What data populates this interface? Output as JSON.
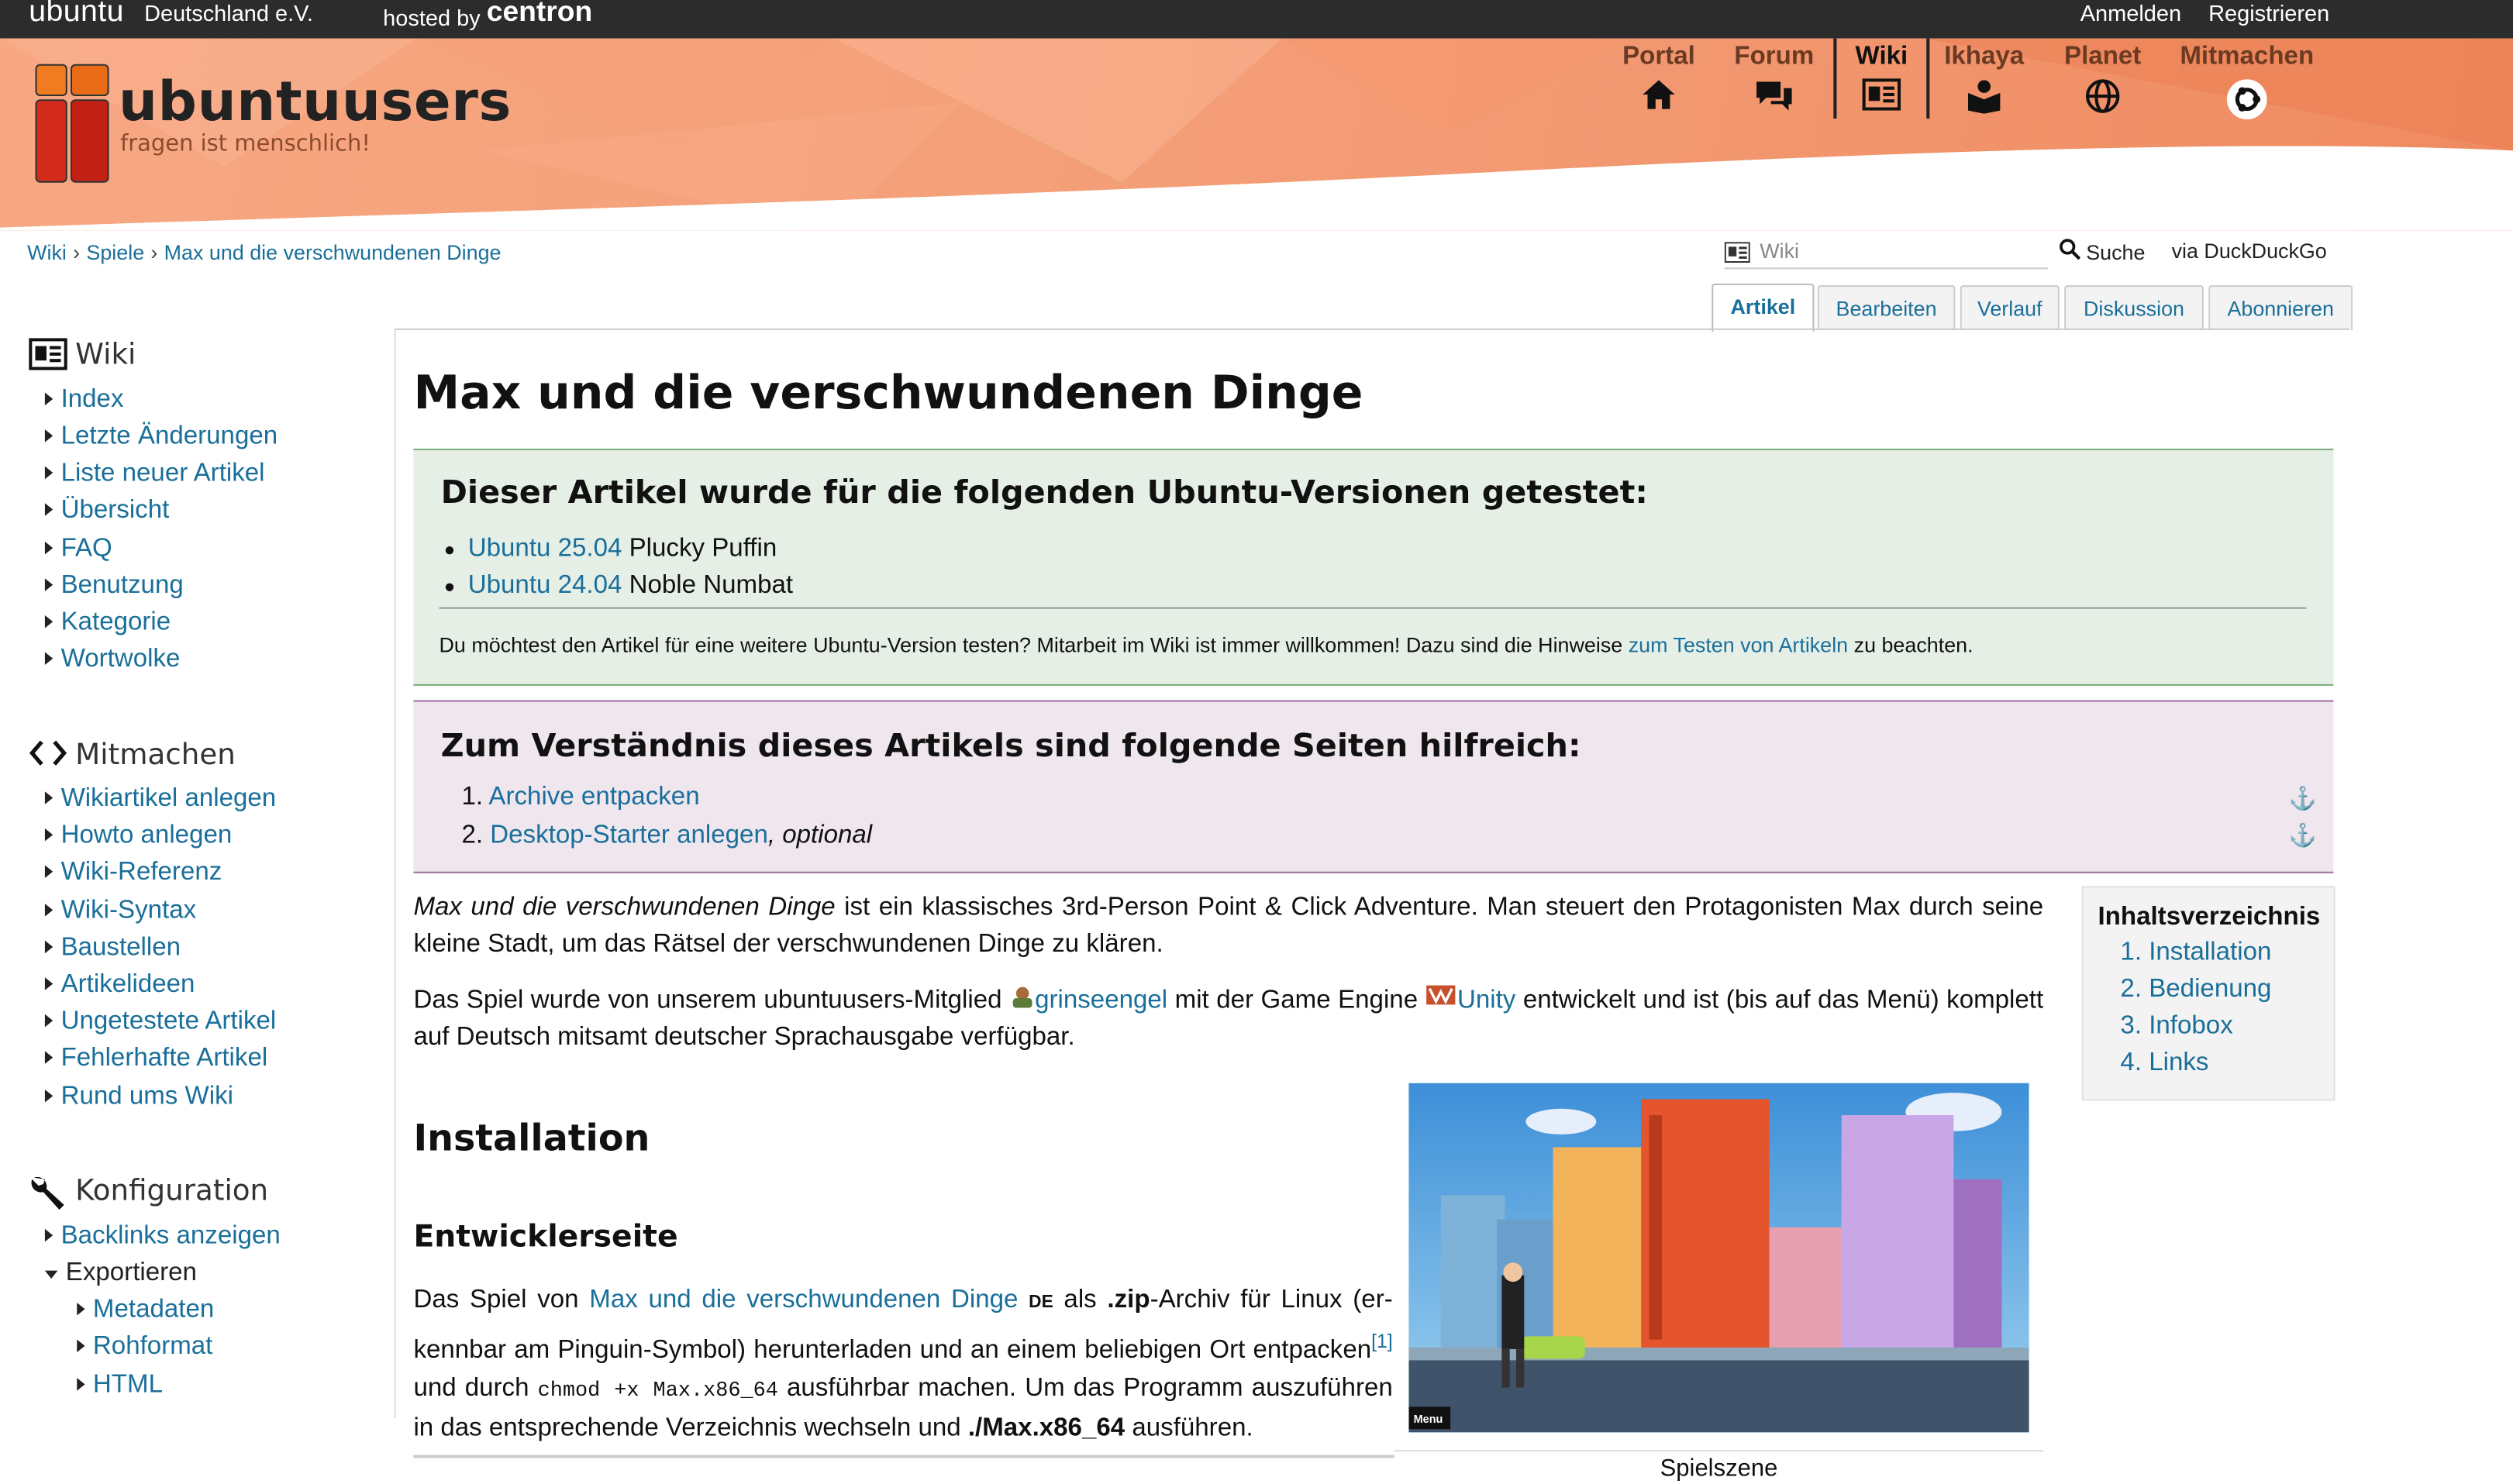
{
  "topbar": {
    "ubuntu": "ubuntu",
    "ubuntu_sub": "Deutschland e.V.",
    "hosted_by": "hosted by",
    "hosted_brand": "centron",
    "login": "Anmelden",
    "register": "Registrieren"
  },
  "header": {
    "brand": "ubuntuusers",
    "tagline": "fragen ist menschlich!",
    "nav": [
      {
        "label": "Portal",
        "icon": "home-icon"
      },
      {
        "label": "Forum",
        "icon": "chat-icon"
      },
      {
        "label": "Wiki",
        "icon": "wiki-icon",
        "active": true
      },
      {
        "label": "Ikhaya",
        "icon": "news-icon"
      },
      {
        "label": "Planet",
        "icon": "globe-icon"
      },
      {
        "label": "Mitmachen",
        "icon": "ubuntu-circle-icon"
      }
    ]
  },
  "breadcrumb": [
    "Wiki",
    "Spiele",
    "Max und die verschwundenen Dinge"
  ],
  "search": {
    "placeholder": "Wiki",
    "button": "Suche",
    "via": "via DuckDuckGo"
  },
  "tabs": [
    "Artikel",
    "Bearbeiten",
    "Verlauf",
    "Diskussion",
    "Abonnieren"
  ],
  "sidebar": {
    "wiki": {
      "heading": "Wiki",
      "items": [
        "Index",
        "Letzte Änderungen",
        "Liste neuer Artikel",
        "Übersicht",
        "FAQ",
        "Benutzung",
        "Kategorie",
        "Wortwolke"
      ]
    },
    "mitmachen": {
      "heading": "Mitmachen",
      "items": [
        "Wikiartikel anlegen",
        "Howto anlegen",
        "Wiki-Referenz",
        "Wiki-Syntax",
        "Baustellen",
        "Artikelideen",
        "Ungetestete Artikel",
        "Fehlerhafte Artikel",
        "Rund ums Wiki"
      ]
    },
    "konfiguration": {
      "heading": "Konfiguration",
      "items": [
        "Backlinks anzeigen"
      ],
      "export_label": "Exportieren",
      "export_items": [
        "Metadaten",
        "Rohformat",
        "HTML"
      ]
    }
  },
  "article": {
    "title": "Max und die verschwundenen Dinge",
    "tested": {
      "heading": "Dieser Artikel wurde für die folgenden Ubuntu-Versionen getestet:",
      "versions": [
        {
          "version": "Ubuntu 25.04",
          "name": "Plucky Puffin"
        },
        {
          "version": "Ubuntu 24.04",
          "name": "Noble Numbat"
        }
      ],
      "note_pre": "Du möchtest den Artikel für eine weitere Ubuntu-Version testen? Mitarbeit im Wiki ist immer willkommen! Dazu sind die Hinweise",
      "note_link": "zum Testen von Artikeln",
      "note_post": "zu beachten."
    },
    "prereq": {
      "heading": "Zum Verständnis dieses Artikels sind folgende Seiten hilfreich:",
      "items": [
        {
          "n": "1.",
          "link": "Archive entpacken",
          "suffix": ""
        },
        {
          "n": "2.",
          "link": "Desktop-Starter anlegen",
          "suffix": ", optional"
        }
      ],
      "anchor": "⚓"
    },
    "intro1_em": "Max und die verschwundenen Dinge",
    "intro1": " ist ein klassisches 3rd-Person Point & Click Adventure. Man steuert den Protagonisten Max durch seine kleine Stadt, um das Rätsel der verschwundenen Dinge zu klären.",
    "intro2_a": "Das Spiel wurde von unserem ubuntuusers-Mitglied ",
    "intro2_user": "grinseengel",
    "intro2_b": " mit der Game Engine ",
    "intro2_engine": "Unity",
    "intro2_c": " entwickelt und ist (bis auf das Menü) kom­plett auf Deutsch mitsamt deutscher Sprachausgabe verfügbar.",
    "toc": {
      "heading": "Inhaltsverzeichnis",
      "items": [
        "1. Installation",
        "2. Bedienung",
        "3. Infobox",
        "4. Links"
      ]
    },
    "h_install": "Installation",
    "h_dev": "Entwicklerseite",
    "dev_a": "Das Spiel von ",
    "dev_link": "Max und die verschwundenen Dinge",
    "dev_lang": "DE",
    "dev_b": " als ",
    "dev_zip": ".zip",
    "dev_c": "-Archiv für Linux (er­kennbar am Pinguin-Symbol) herunterladen und an einem beliebigen Ort entpacken",
    "dev_fn": "[1]",
    "dev_d": " und durch ",
    "dev_cmd": "chmod +x Max.x86_64",
    "dev_e": " ausführbar machen. Um das Programm auszuführen in das entsprechende Verzeichnis wechseln und ",
    "dev_exec": "./Max.x86_64",
    "dev_f": " ausführen.",
    "figure_caption": "Spielszene",
    "figure_menu": "Menu"
  },
  "colors": {
    "link": "#1a6f9a",
    "header_orange": "#f39a73",
    "green_box": "#e6efe6",
    "purple_box": "#efe6ee"
  }
}
